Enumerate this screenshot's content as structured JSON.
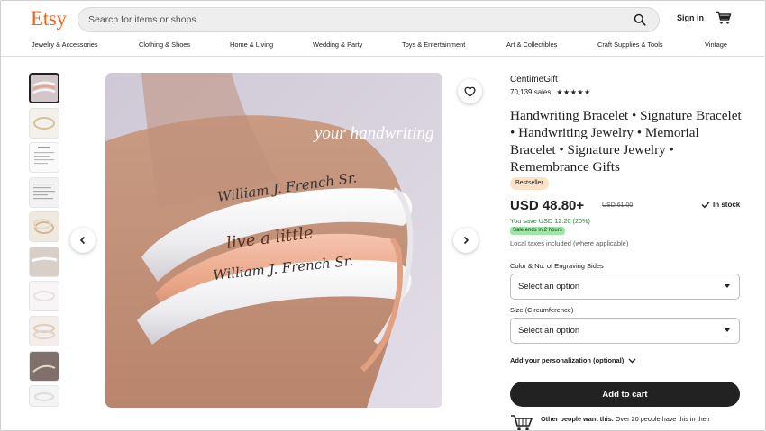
{
  "header": {
    "logo": "Etsy",
    "search_placeholder": "Search for items or shops",
    "signin": "Sign in"
  },
  "categories": [
    "Jewelry & Accessories",
    "Clothing & Shoes",
    "Home & Living",
    "Wedding & Party",
    "Toys & Entertainment",
    "Art & Collectibles",
    "Craft Supplies & Tools",
    "Vintage"
  ],
  "image": {
    "overlay_text": "your handwriting",
    "engraving_1": "William J. French Sr.",
    "engraving_2": "live a little",
    "engraving_3": "William J. French Sr."
  },
  "listing": {
    "shop_name": "CentimeGift",
    "sales": "70,139 sales",
    "stars": "★★★★★",
    "title": "Handwriting Bracelet • Signature Bracelet • Handwriting Jewelry • Memorial Bracelet • Signature Jewelry • Remembrance Gifts",
    "badge": "Bestseller",
    "price": "USD 48.80+",
    "original_price": "USD 61.00",
    "stock": "In stock",
    "savings": "You save USD 12.20 (20%)",
    "sale_ends": "Sale ends in 2 hours",
    "taxes": "Local taxes included (where applicable)",
    "option1_label": "Color & No. of Engraving Sides",
    "option1_value": "Select an option",
    "option2_label": "Size (Circumference)",
    "option2_value": "Select an option",
    "personalization": "Add your personalization (optional)",
    "add_to_cart": "Add to cart",
    "others_bold": "Other people want this.",
    "others_rest": " Over 20 people have this in their"
  },
  "colors": {
    "brand": "#f1641e",
    "button": "#222222",
    "savings": "#258635",
    "sale_badge": "#9ee6a7",
    "bestseller_badge": "#fde2c8"
  }
}
